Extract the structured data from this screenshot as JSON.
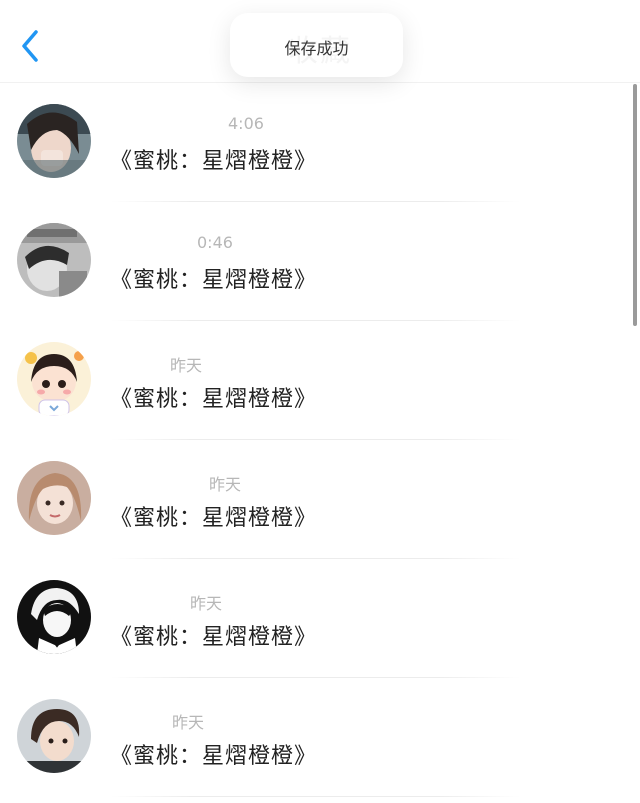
{
  "nav": {
    "title": "收藏",
    "back_icon": "chevron-left-icon",
    "accent": "#2196f3"
  },
  "toast": {
    "text": "保存成功"
  },
  "conversations": [
    {
      "time": "4:06",
      "name": "《蜜桃：星熠橙橙》",
      "avatar": "avatar-photo-girl-covering-face"
    },
    {
      "time": "0:46",
      "name": "《蜜桃：星熠橙橙》",
      "avatar": "avatar-photo-boy-grayscale"
    },
    {
      "time": "昨天",
      "name": "《蜜桃：星熠橙橙》",
      "avatar": "avatar-cartoon-chibi"
    },
    {
      "time": "昨天",
      "name": "《蜜桃：星熠橙橙》",
      "avatar": "avatar-photo-girl-sepia"
    },
    {
      "time": "昨天",
      "name": "《蜜桃：星熠橙橙》",
      "avatar": "avatar-anime-boy-dark"
    },
    {
      "time": "昨天",
      "name": "《蜜桃：星熠橙橙》",
      "avatar": "avatar-photo-boy-color"
    }
  ]
}
